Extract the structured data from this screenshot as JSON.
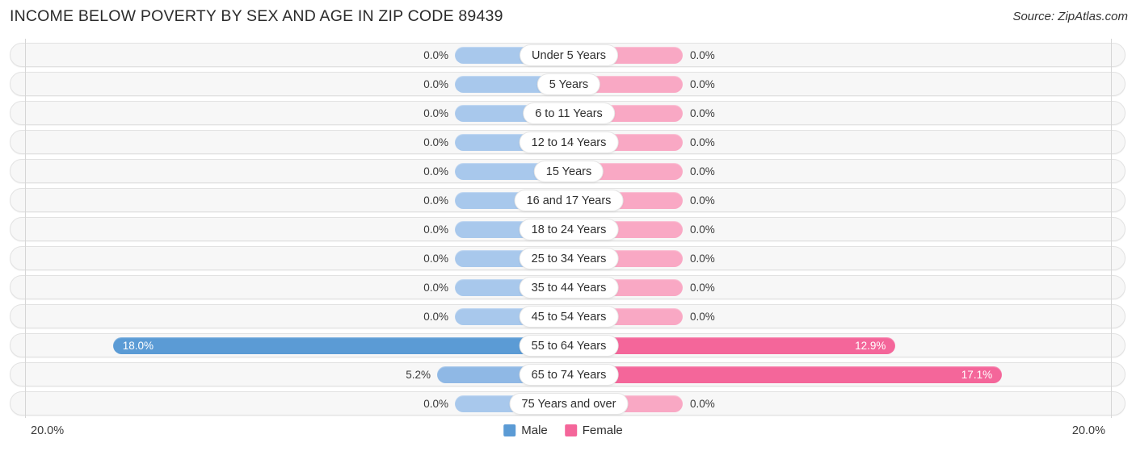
{
  "header": {
    "title": "INCOME BELOW POVERTY BY SEX AND AGE IN ZIP CODE 89439",
    "source": "Source: ZipAtlas.com"
  },
  "axis": {
    "left_tick": "20.0%",
    "right_tick": "20.0%",
    "max_percent": 20
  },
  "legend": {
    "male_label": "Male",
    "female_label": "Female",
    "male_color": "#5b9bd5",
    "female_color": "#f4669a"
  },
  "colors": {
    "male_strong": "#5b9bd5",
    "male_mid": "#8fb8e5",
    "male_light": "#a8c8ec",
    "female_strong": "#f4669a",
    "female_mid": "#f57da9",
    "female_light": "#f9a8c4",
    "row_bg": "#f7f7f7",
    "row_border": "#e2e2e2",
    "axis_line": "#d6d6d6"
  },
  "chart_data": {
    "type": "bar",
    "orientation": "horizontal-diverging",
    "title": "INCOME BELOW POVERTY BY SEX AND AGE IN ZIP CODE 89439",
    "xlabel": "",
    "ylabel": "",
    "xlim": [
      20,
      20
    ],
    "grid": false,
    "legend_position": "bottom-center",
    "categories": [
      "Under 5 Years",
      "5 Years",
      "6 to 11 Years",
      "12 to 14 Years",
      "15 Years",
      "16 and 17 Years",
      "18 to 24 Years",
      "25 to 34 Years",
      "35 to 44 Years",
      "45 to 54 Years",
      "55 to 64 Years",
      "65 to 74 Years",
      "75 Years and over"
    ],
    "series": [
      {
        "name": "Male",
        "values": [
          0.0,
          0.0,
          0.0,
          0.0,
          0.0,
          0.0,
          0.0,
          0.0,
          0.0,
          0.0,
          18.0,
          5.2,
          0.0
        ]
      },
      {
        "name": "Female",
        "values": [
          0.0,
          0.0,
          0.0,
          0.0,
          0.0,
          0.0,
          0.0,
          0.0,
          0.0,
          0.0,
          12.9,
          17.1,
          0.0
        ]
      }
    ]
  },
  "rows": [
    {
      "label": "Under 5 Years",
      "male": "0.0%",
      "female": "0.0%",
      "male_value": 0.0,
      "female_value": 0.0
    },
    {
      "label": "5 Years",
      "male": "0.0%",
      "female": "0.0%",
      "male_value": 0.0,
      "female_value": 0.0
    },
    {
      "label": "6 to 11 Years",
      "male": "0.0%",
      "female": "0.0%",
      "male_value": 0.0,
      "female_value": 0.0
    },
    {
      "label": "12 to 14 Years",
      "male": "0.0%",
      "female": "0.0%",
      "male_value": 0.0,
      "female_value": 0.0
    },
    {
      "label": "15 Years",
      "male": "0.0%",
      "female": "0.0%",
      "male_value": 0.0,
      "female_value": 0.0
    },
    {
      "label": "16 and 17 Years",
      "male": "0.0%",
      "female": "0.0%",
      "male_value": 0.0,
      "female_value": 0.0
    },
    {
      "label": "18 to 24 Years",
      "male": "0.0%",
      "female": "0.0%",
      "male_value": 0.0,
      "female_value": 0.0
    },
    {
      "label": "25 to 34 Years",
      "male": "0.0%",
      "female": "0.0%",
      "male_value": 0.0,
      "female_value": 0.0
    },
    {
      "label": "35 to 44 Years",
      "male": "0.0%",
      "female": "0.0%",
      "male_value": 0.0,
      "female_value": 0.0
    },
    {
      "label": "45 to 54 Years",
      "male": "0.0%",
      "female": "0.0%",
      "male_value": 0.0,
      "female_value": 0.0
    },
    {
      "label": "55 to 64 Years",
      "male": "18.0%",
      "female": "12.9%",
      "male_value": 18.0,
      "female_value": 12.9
    },
    {
      "label": "65 to 74 Years",
      "male": "5.2%",
      "female": "17.1%",
      "male_value": 5.2,
      "female_value": 17.1
    },
    {
      "label": "75 Years and over",
      "male": "0.0%",
      "female": "0.0%",
      "male_value": 0.0,
      "female_value": 0.0
    }
  ]
}
